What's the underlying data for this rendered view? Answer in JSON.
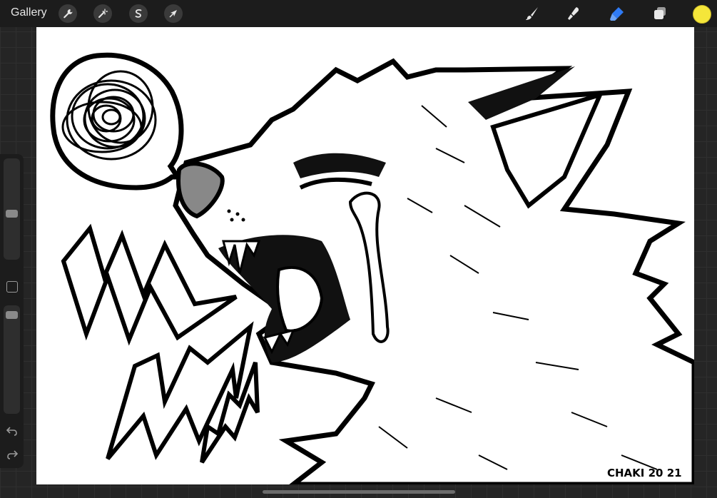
{
  "toolbar": {
    "gallery_label": "Gallery",
    "left_tools": [
      {
        "name": "actions",
        "icon": "wrench-icon"
      },
      {
        "name": "adjustments",
        "icon": "magic-wand-icon"
      },
      {
        "name": "selection",
        "icon": "selection-s-icon"
      },
      {
        "name": "transform",
        "icon": "arrow-cursor-icon"
      }
    ],
    "right_tools": [
      {
        "name": "brush",
        "icon": "brush-icon"
      },
      {
        "name": "smudge",
        "icon": "smudge-icon"
      },
      {
        "name": "eraser",
        "icon": "eraser-icon",
        "active_color": "#2f7bf5"
      },
      {
        "name": "layers",
        "icon": "layers-icon"
      }
    ],
    "current_color": "#f5e63a"
  },
  "canvas": {
    "signature": "CHAKI 20 21",
    "background_color": "#ffffff"
  },
  "sidebar": {
    "brush_size_level": 0.45,
    "opacity_level": 0.96,
    "undo_icon": "undo-icon",
    "redo_icon": "redo-icon"
  }
}
